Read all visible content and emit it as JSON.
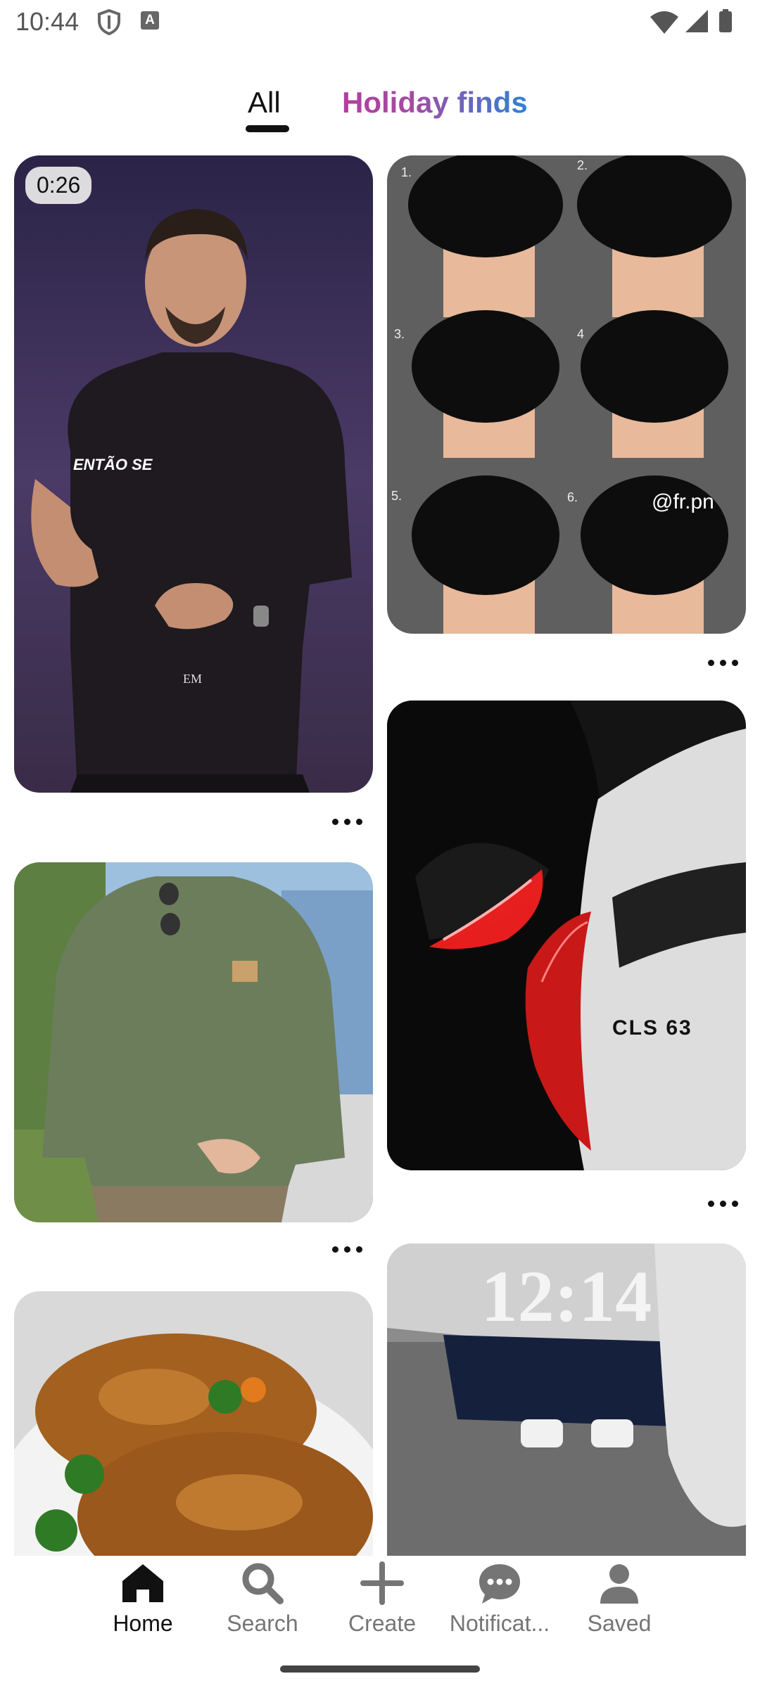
{
  "status": {
    "time": "10:44"
  },
  "tabs": {
    "all": "All",
    "holiday": "Holiday finds"
  },
  "pins": {
    "video": {
      "duration": "0:26",
      "shirt_text": "ENTÃO SE",
      "em_text": "EM"
    },
    "haircut": {
      "labels": [
        "1.",
        "2.",
        "3.",
        "4",
        "5.",
        "6."
      ],
      "watermark": "@fr.pn"
    },
    "car": {
      "badge": "CLS 63"
    },
    "clock": {
      "time": "12:14"
    }
  },
  "nav": {
    "home": "Home",
    "search": "Search",
    "create": "Create",
    "notifications": "Notificat...",
    "saved": "Saved"
  }
}
